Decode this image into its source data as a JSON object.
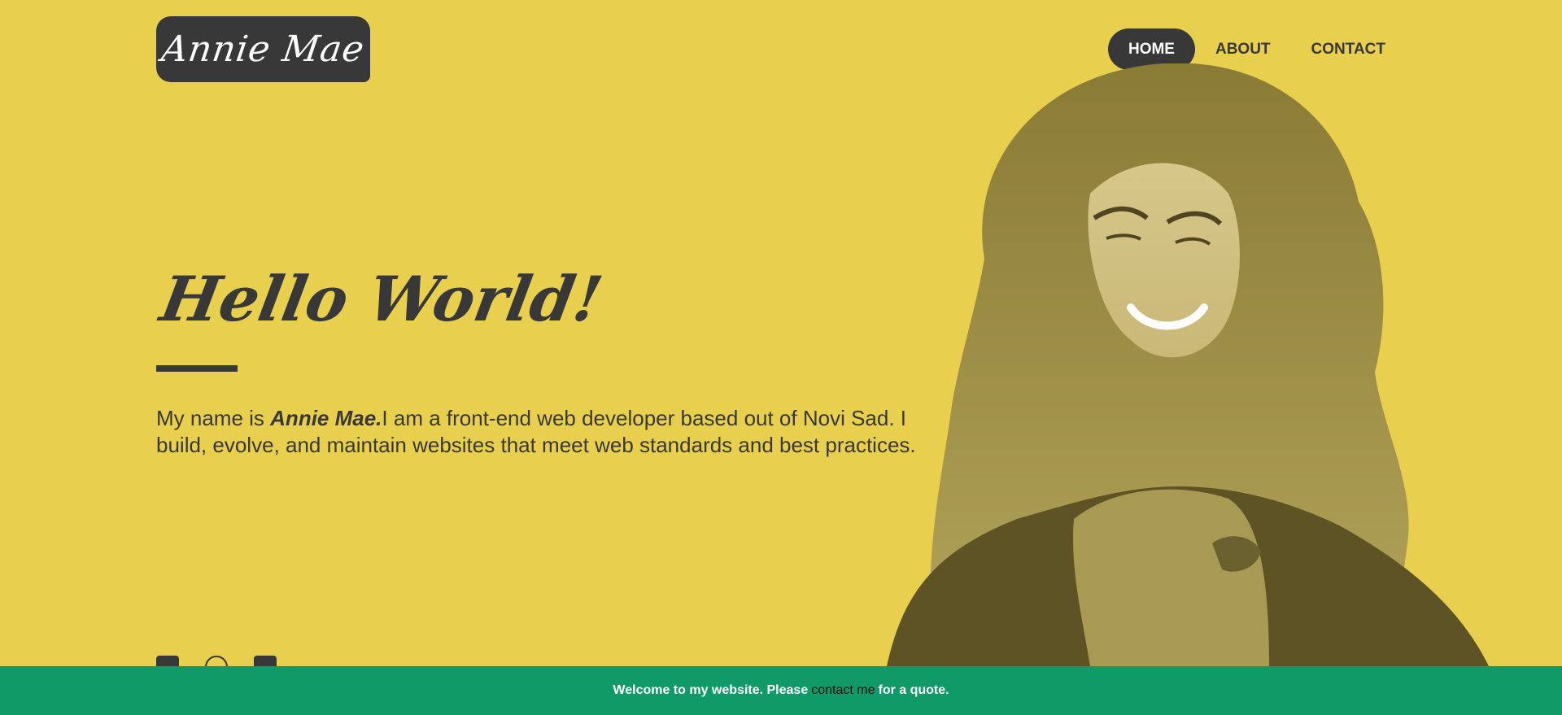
{
  "brand": {
    "logo_text": "Annie Mae"
  },
  "nav": {
    "items": [
      {
        "label": "HOME",
        "active": true
      },
      {
        "label": "ABOUT",
        "active": false
      },
      {
        "label": "CONTACT",
        "active": false
      }
    ]
  },
  "hero": {
    "title": "Hello World!",
    "intro_prefix": "My name is ",
    "intro_name": "Annie Mae.",
    "intro_rest": "I am a front-end web developer based out of Novi Sad. I build, evolve, and maintain websites that meet web standards and best practices."
  },
  "socials": [
    "facebook-icon",
    "github-icon",
    "chat-icon"
  ],
  "banner": {
    "prefix": "Welcome to my website. Please ",
    "link_label": "contact me",
    "suffix": " for a quote."
  },
  "colors": {
    "background": "#e8cf4d",
    "dark": "#383838",
    "banner": "#0f9a67"
  }
}
